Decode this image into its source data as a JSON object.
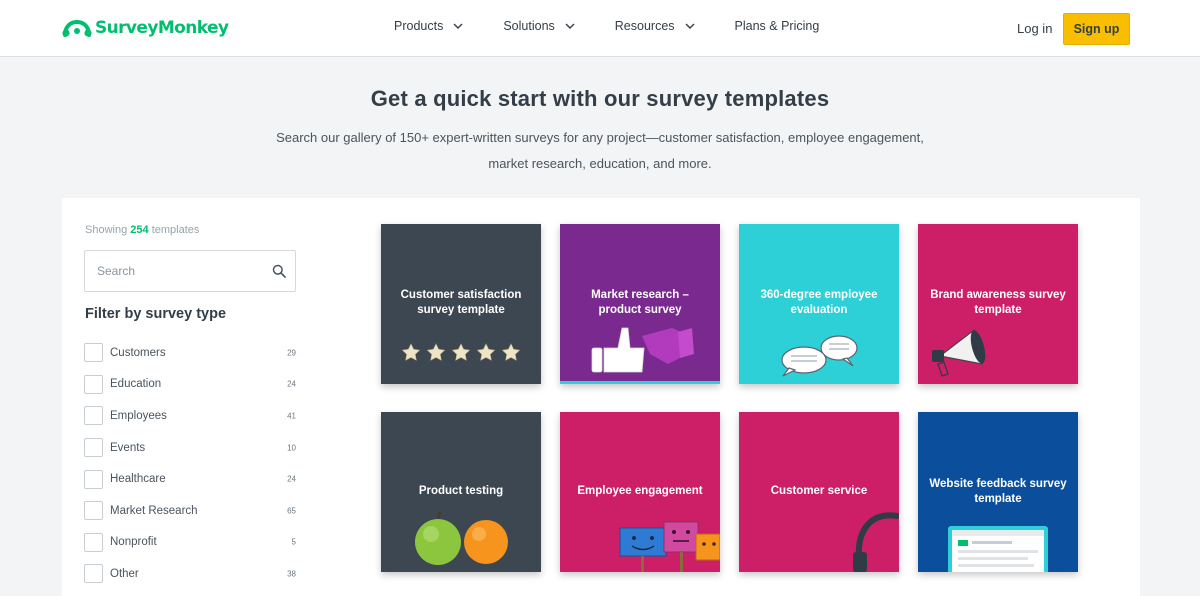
{
  "header": {
    "logo_text": "SurveyMonkey",
    "logo_icon": "surveymonkey-logo-icon",
    "nav": [
      {
        "label": "Products",
        "icon": "chevron-down-icon"
      },
      {
        "label": "Solutions",
        "icon": "chevron-down-icon"
      },
      {
        "label": "Resources",
        "icon": "chevron-down-icon"
      },
      {
        "label": "Plans & Pricing"
      }
    ],
    "login_label": "Log in",
    "signup_label": "Sign up"
  },
  "hero": {
    "title": "Get a quick start with our survey templates",
    "subtitle": "Search our gallery of 150+ expert-written surveys for any project—customer satisfaction, employee engagement, market research, education, and more."
  },
  "sidebar": {
    "showing_prefix": "Showing",
    "showing_count": "254",
    "showing_suffix": "templates",
    "search_placeholder": "Search",
    "search_value": "",
    "filter_title": "Filter by survey type",
    "filters": [
      {
        "label": "Customers",
        "count": "29"
      },
      {
        "label": "Education",
        "count": "24"
      },
      {
        "label": "Employees",
        "count": "41"
      },
      {
        "label": "Events",
        "count": "10"
      },
      {
        "label": "Healthcare",
        "count": "24"
      },
      {
        "label": "Market Research",
        "count": "65"
      },
      {
        "label": "Nonprofit",
        "count": "5"
      },
      {
        "label": "Other",
        "count": "38"
      }
    ]
  },
  "templates": [
    {
      "title": "Customer satisfaction survey template",
      "icon": "five-stars-icon",
      "color": "#3c4752"
    },
    {
      "title": "Market research – product survey",
      "icon": "thumbs-up-down-icon",
      "color": "#7a2a8f"
    },
    {
      "title": "360-degree employee evaluation",
      "icon": "speech-bubbles-icon",
      "color": "#2ed0d8"
    },
    {
      "title": "Brand awareness survey template",
      "icon": "megaphone-icon",
      "color": "#cc1f68"
    },
    {
      "title": "Product testing",
      "icon": "apple-orange-icon",
      "color": "#3c4752"
    },
    {
      "title": "Employee engagement",
      "icon": "smiley-signs-icon",
      "color": "#cc1f68"
    },
    {
      "title": "Customer service",
      "icon": "headset-icon",
      "color": "#cc1f68"
    },
    {
      "title": "Website feedback survey template",
      "icon": "browser-window-icon",
      "color": "#0b4f9c"
    }
  ],
  "colors": {
    "brand_green": "#00bf6f",
    "signup_yellow": "#f9be00",
    "text_dark": "#333e48"
  }
}
